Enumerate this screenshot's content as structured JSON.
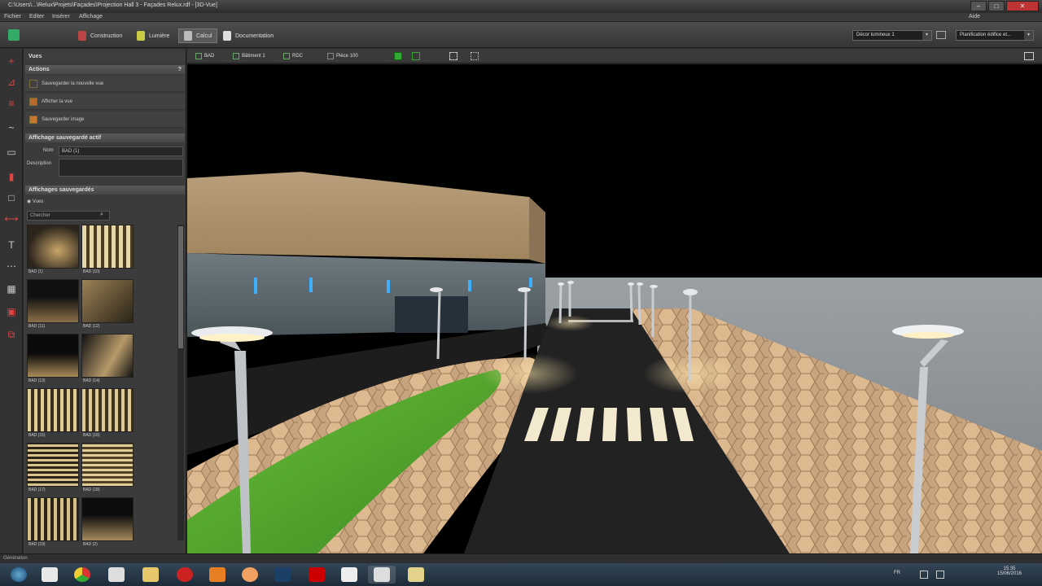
{
  "window": {
    "title": "C:\\Users\\...\\Relux\\Projets\\Façades\\Projection Hall 3 - Façades Relux.rdf - [3D-Vue]",
    "buttons": {
      "minimize": "–",
      "maximize": "□",
      "close": "✕"
    },
    "help_label": "Aide"
  },
  "menu": [
    "Fichier",
    "Editer",
    "Insérer",
    "Affichage"
  ],
  "ribbon": {
    "tabs": [
      {
        "label": "Construction",
        "icon": "construction-icon",
        "color": "#c44"
      },
      {
        "label": "Lumière",
        "icon": "lamp-icon",
        "color": "#cc4"
      },
      {
        "label": "Calcul",
        "icon": "calculator-icon",
        "color": "#ccc",
        "active": true
      },
      {
        "label": "Documentation",
        "icon": "document-icon",
        "color": "#ddd"
      }
    ],
    "scene_select": "Décor lumineux 1",
    "plan_select": "Planification édifice et..."
  },
  "left_tools": [
    "+",
    "⊿",
    "≡",
    "~",
    "▭",
    "▮",
    "□",
    "⟷",
    "T",
    "⋯",
    "▦",
    "▣",
    "⧉"
  ],
  "panel": {
    "view_header": "Vues",
    "actions_header": "Actions",
    "help": "?",
    "actions": [
      "Sauvegarder la nouvelle vue",
      "Afficher la vue",
      "Sauvegarder image"
    ],
    "active_header": "Affichage sauvegardé actif",
    "name_label": "Nom",
    "name_value": "BAD (1)",
    "description_label": "Description",
    "saved_header": "Affichages sauvegardés",
    "saved_filter": "Vues",
    "search_placeholder": "Chercher",
    "thumbnails": [
      "BAD (1)",
      "BAD (10)",
      "BAD (11)",
      "BAD (12)",
      "BAD (13)",
      "BAD (14)",
      "BAD (15)",
      "BAD (16)",
      "BAD (17)",
      "BAD (18)",
      "BAD (19)",
      "BAD (2)"
    ]
  },
  "view_toolbar": {
    "items": [
      {
        "label": "BAD",
        "icon": "camera-icon"
      },
      {
        "label": "Bâtiment 1",
        "icon": "building-icon"
      },
      {
        "label": "RDC",
        "icon": "floor-icon"
      },
      {
        "label": "Pièce 100",
        "icon": "room-icon"
      }
    ]
  },
  "status": {
    "text": "Génération"
  },
  "taskbar": {
    "apps": [
      "start",
      "explorer",
      "chrome",
      "relux",
      "folder",
      "acrobat",
      "office",
      "media",
      "opera",
      "adobe",
      "calc",
      "relux-2",
      "photos"
    ],
    "tray": {
      "lang": "FR",
      "time": "15:35",
      "date": "15/06/2016"
    }
  }
}
